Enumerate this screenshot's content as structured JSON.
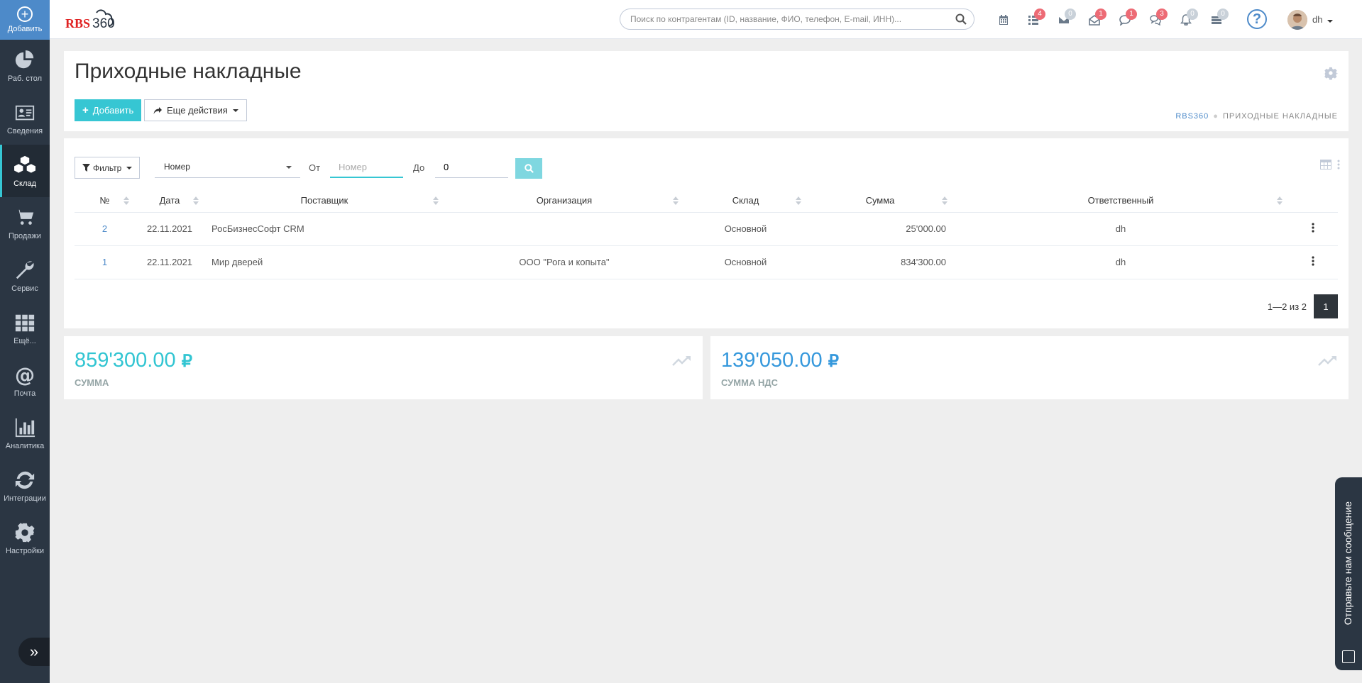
{
  "sidebar": {
    "add_label": "Добавить",
    "items": [
      {
        "label": "Раб. стол",
        "icon": "pie-chart-icon"
      },
      {
        "label": "Сведения",
        "icon": "id-card-icon"
      },
      {
        "label": "Склад",
        "icon": "cubes-icon",
        "active": true
      },
      {
        "label": "Продажи",
        "icon": "cart-icon"
      },
      {
        "label": "Сервис",
        "icon": "wrench-icon"
      },
      {
        "label": "Ещё...",
        "icon": "grid-icon"
      },
      {
        "label": "Почта",
        "icon": "at-icon"
      },
      {
        "label": "Аналитика",
        "icon": "bar-chart-icon"
      },
      {
        "label": "Интеграции",
        "icon": "sync-icon"
      },
      {
        "label": "Настройки",
        "icon": "gear-icon"
      }
    ],
    "collapse_glyph": "»"
  },
  "header": {
    "logo_rbs": "RBS",
    "logo_num": "360",
    "search_placeholder": "Поиск по контрагентам (ID, название, ФИО, телефон, E-mail, ИНН)...",
    "badges": {
      "tasks": "4",
      "mail": "0",
      "messages": "1",
      "chat": "1",
      "comments": "3",
      "notifications": "0",
      "stack": "0"
    },
    "help_glyph": "?",
    "user": "dh"
  },
  "page": {
    "title": "Приходные накладные",
    "add_button": "Добавить",
    "more_button": "Еще действия",
    "breadcrumb_home": "RBS360",
    "breadcrumb_current": "ПРИХОДНЫЕ НАКЛАДНЫЕ"
  },
  "filter": {
    "filter_button": "Фильтр",
    "field_select": "Номер",
    "from_label": "От",
    "from_placeholder": "Номер",
    "to_label": "До",
    "to_value": "0"
  },
  "table": {
    "columns": [
      "№",
      "Дата",
      "Поставщик",
      "Организация",
      "Склад",
      "Сумма",
      "Ответственный"
    ],
    "rows": [
      {
        "num": "2",
        "date": "22.11.2021",
        "supplier": "РосБизнесСофт CRM",
        "org": "",
        "warehouse": "Основной",
        "sum": "25'000.00",
        "responsible": "dh"
      },
      {
        "num": "1",
        "date": "22.11.2021",
        "supplier": "Мир дверей",
        "org": "ООО \"Рога и копыта\"",
        "warehouse": "Основной",
        "sum": "834'300.00",
        "responsible": "dh"
      }
    ],
    "pager_text": "1—2 из 2",
    "page": "1"
  },
  "cards": [
    {
      "value": "859'300.00",
      "currency": "₽",
      "label": "СУММА",
      "color": "#32c5d2"
    },
    {
      "value": "139'050.00",
      "currency": "₽",
      "label": "СУММА НДС",
      "color": "#3598dc"
    }
  ],
  "feedback": {
    "label": "Отправьте нам сообщение"
  }
}
